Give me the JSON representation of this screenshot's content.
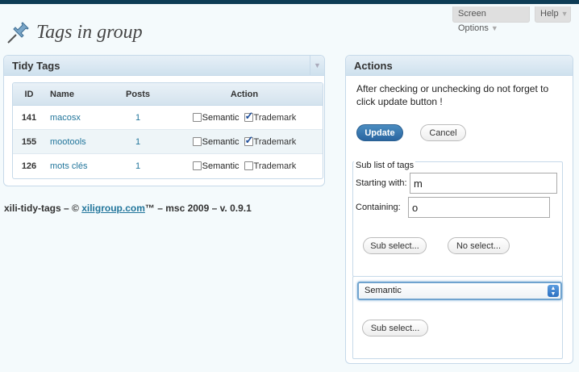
{
  "header": {
    "screen_options": "Screen Options",
    "help": "Help",
    "title": "Tags in group"
  },
  "tidy": {
    "title": "Tidy Tags",
    "columns": [
      "ID",
      "Name",
      "Posts",
      "Action"
    ],
    "rows": [
      {
        "id": "141",
        "name": "macosx",
        "posts": "1",
        "semantic": false,
        "trademark": true
      },
      {
        "id": "155",
        "name": "mootools",
        "posts": "1",
        "semantic": false,
        "trademark": true
      },
      {
        "id": "126",
        "name": "mots clés",
        "posts": "1",
        "semantic": false,
        "trademark": false
      }
    ],
    "semantic_label": "Semantic",
    "trademark_label": "Trademark"
  },
  "footer": {
    "prefix": "xili-tidy-tags – © ",
    "link": "xiligroup.com",
    "suffix": "™ – msc 2009 – v. 0.9.1"
  },
  "actions": {
    "title": "Actions",
    "note": "After checking or unchecking do not forget to click update button !",
    "update": "Update",
    "cancel": "Cancel",
    "sublist_legend": "Sub list of tags",
    "starting_label": "Starting with:",
    "starting_value": "m",
    "containing_label": "Containing:",
    "containing_value": "o",
    "sub_select": "Sub select...",
    "no_select": "No select...",
    "group_select": "Semantic",
    "sub_select_2": "Sub select..."
  }
}
